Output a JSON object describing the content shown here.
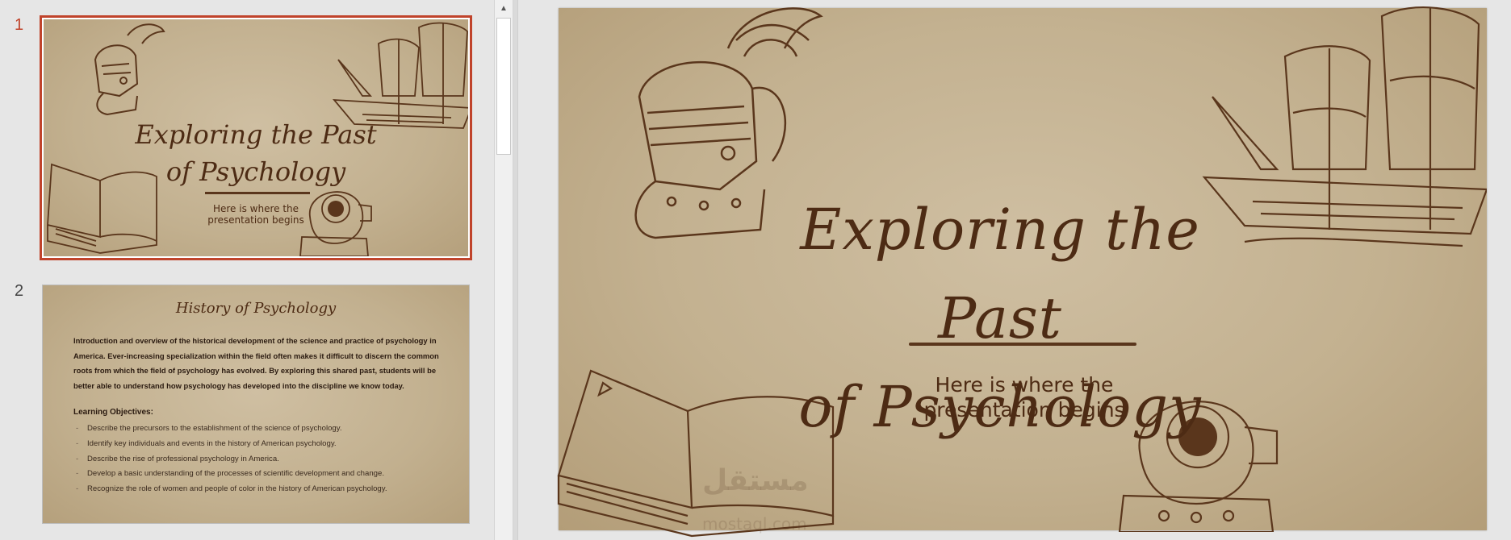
{
  "thumbnail_pane": {
    "slides": [
      {
        "number": "1",
        "title_line1": "Exploring the Past",
        "title_line2": "of Psychology",
        "subtitle_line1": "Here is where the",
        "subtitle_line2": "presentation begins"
      },
      {
        "number": "2",
        "title": "History of Psychology",
        "intro_lines": [
          "Introduction and overview of the historical development of the science and practice of psychology in",
          "America. Ever-increasing specialization within the field often makes it difficult to discern the common",
          "roots from which the field of psychology has evolved. By exploring this shared past, students will be",
          "better able to understand how psychology has developed into the discipline we know today."
        ],
        "objectives_heading": "Learning Objectives:",
        "objectives": [
          "Describe the precursors to the establishment of the science of psychology.",
          "Identify key individuals and events in the history of American psychology.",
          "Describe the rise of professional psychology in America.",
          "Develop a basic understanding of the processes of scientific development and change.",
          "Recognize the role of women and people of color in the history of American psychology."
        ]
      }
    ]
  },
  "main_slide": {
    "title_line1": "Exploring the Past",
    "title_line2": "of Psychology",
    "subtitle_line1": "Here is where the",
    "subtitle_line2": "presentation begins",
    "watermark": "مستقل",
    "watermark_sub": "mostaql.com"
  },
  "theme": {
    "accent_selected": "#c0432b",
    "ink": "#4d2b14",
    "parchment": "#c3b190"
  },
  "icons": [
    "knight-helmet-icon",
    "sailing-ship-icon",
    "open-book-icon",
    "diving-helmet-icon",
    "scroll-up-arrow-icon"
  ]
}
